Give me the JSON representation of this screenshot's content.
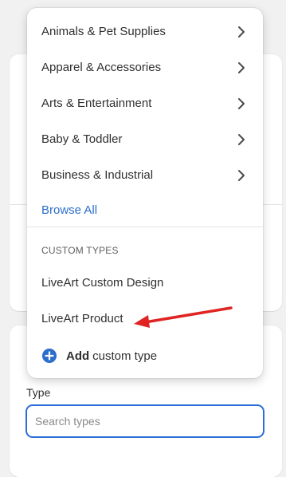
{
  "categories": [
    {
      "label": "Animals & Pet Supplies",
      "icon": "chevron-right-icon"
    },
    {
      "label": "Apparel & Accessories",
      "icon": "chevron-right-icon"
    },
    {
      "label": "Arts & Entertainment",
      "icon": "chevron-right-icon"
    },
    {
      "label": "Baby & Toddler",
      "icon": "chevron-right-icon"
    },
    {
      "label": "Business & Industrial",
      "icon": "chevron-right-icon"
    }
  ],
  "browse_all_label": "Browse All",
  "custom_types": {
    "heading": "CUSTOM TYPES",
    "items": [
      "LiveArt Custom Design",
      "LiveArt Product"
    ],
    "add": {
      "icon": "plus-circle-icon",
      "strong": "Add",
      "rest": "custom type"
    }
  },
  "type_field": {
    "label": "Type",
    "placeholder": "Search types",
    "value": ""
  },
  "colors": {
    "link": "#2c6ecb",
    "focus_border": "#2a6fd6",
    "annotation_arrow": "#e02424"
  }
}
